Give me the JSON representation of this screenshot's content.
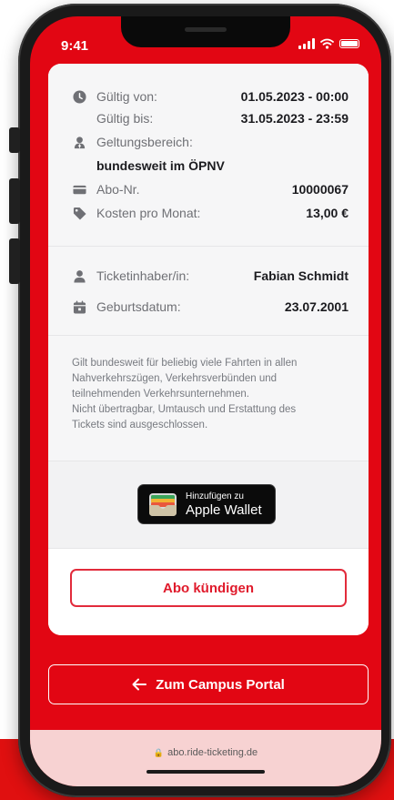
{
  "status_bar": {
    "time": "9:41"
  },
  "ticket": {
    "valid_from_label": "Gültig von:",
    "valid_from_value": "01.05.2023 - 00:00",
    "valid_to_label": "Gültig bis:",
    "valid_to_value": "31.05.2023 - 23:59",
    "scope_label": "Geltungsbereich:",
    "scope_value": "bundesweit im ÖPNV",
    "abo_label": "Abo-Nr.",
    "abo_value": "10000067",
    "cost_label": "Kosten pro Monat:",
    "cost_value": "13,00 €"
  },
  "holder": {
    "name_label": "Ticketinhaber/in:",
    "name_value": "Fabian Schmidt",
    "birth_label": "Geburtsdatum:",
    "birth_value": "23.07.2001"
  },
  "fineprint": {
    "line1": "Gilt bundesweit für beliebig viele Fahrten in allen",
    "line2": "Nahverkehrszügen, Verkehrsverbünden und",
    "line3": "teilnehmenden Verkehrsunternehmen.",
    "line4": "Nicht übertragbar, Umtausch und Erstattung des",
    "line5": "Tickets sind ausgeschlossen."
  },
  "wallet": {
    "line1": "Hinzufügen zu",
    "line2": "Apple Wallet"
  },
  "actions": {
    "cancel_label": "Abo kündigen",
    "portal_label": "Zum Campus Portal"
  },
  "browser": {
    "url": "abo.ride-ticketing.de"
  },
  "colors": {
    "brand_red": "#e20613",
    "accent_red": "#e22b3b",
    "card_bg": "#f6f6f7"
  },
  "icons": [
    "clock-icon",
    "user-location-icon",
    "credit-card-icon",
    "tag-icon",
    "user-icon",
    "calendar-icon",
    "wallet-icon",
    "arrow-left-icon",
    "lock-icon"
  ]
}
